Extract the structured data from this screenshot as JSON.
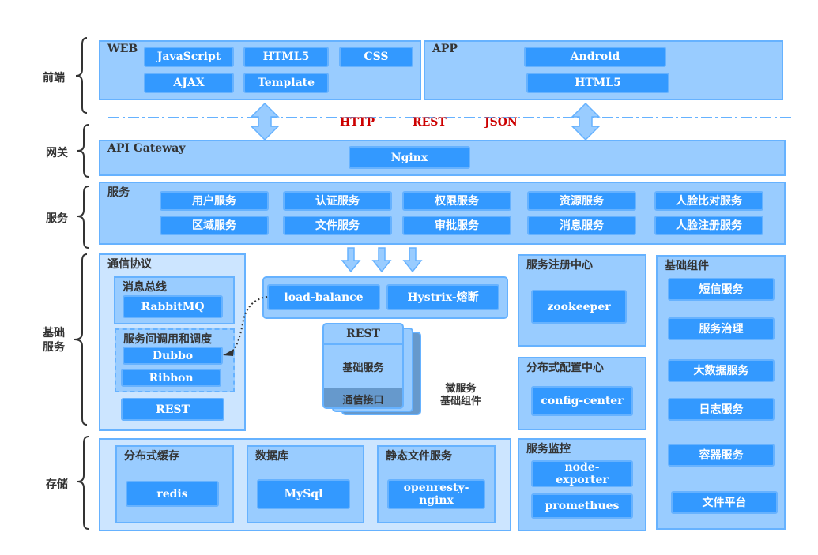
{
  "layers": {
    "frontend": "前端",
    "gateway": "网关",
    "service": "服务",
    "foundation": "基础\n服务",
    "storage": "存储"
  },
  "web": {
    "title": "WEB",
    "items": [
      "JavaScript",
      "HTML5",
      "CSS",
      "AJAX",
      "Template"
    ]
  },
  "app": {
    "title": "APP",
    "items": [
      "Android",
      "HTML5"
    ]
  },
  "protocols": [
    "HTTP",
    "REST",
    "JSON"
  ],
  "gateway": {
    "title": "API Gateway",
    "item": "Nginx"
  },
  "services": {
    "title": "服务",
    "items": [
      "用户服务",
      "认证服务",
      "权限服务",
      "资源服务",
      "人脸比对服务",
      "区域服务",
      "文件服务",
      "审批服务",
      "消息服务",
      "人脸注册服务"
    ]
  },
  "comm": {
    "title": "通信协议",
    "bus_title": "消息总线",
    "bus_item": "RabbitMQ",
    "rpc_title": "服务间调用和调度",
    "rpc_items": [
      "Dubbo",
      "Ribbon"
    ],
    "rest": "REST"
  },
  "balance": {
    "items": [
      "load-balance",
      "Hystrix-熔断"
    ]
  },
  "micro": {
    "header": "REST",
    "body": "基础服务",
    "footer": "通信接口",
    "caption": "微服务\n基础组件"
  },
  "registry": {
    "title": "服务注册中心",
    "item": "zookeeper"
  },
  "config": {
    "title": "分布式配置中心",
    "item": "config-center"
  },
  "monitor": {
    "title": "服务监控",
    "items": [
      "node-exporter",
      "promethues"
    ]
  },
  "components": {
    "title": "基础组件",
    "items": [
      "短信服务",
      "服务治理",
      "大数据服务",
      "日志服务",
      "容器服务",
      "文件平台"
    ]
  },
  "storage": {
    "cache": {
      "title": "分布式缓存",
      "item": "redis"
    },
    "db": {
      "title": "数据库",
      "item": "MySql"
    },
    "static": {
      "title": "静态文件服务",
      "item": "openresty-nginx"
    }
  },
  "colors": {
    "panel": "#99ccff",
    "panel_light": "#cce5ff",
    "border": "#66b2ff",
    "chip": "#3399ff",
    "protocol_text": "#cc0000"
  }
}
